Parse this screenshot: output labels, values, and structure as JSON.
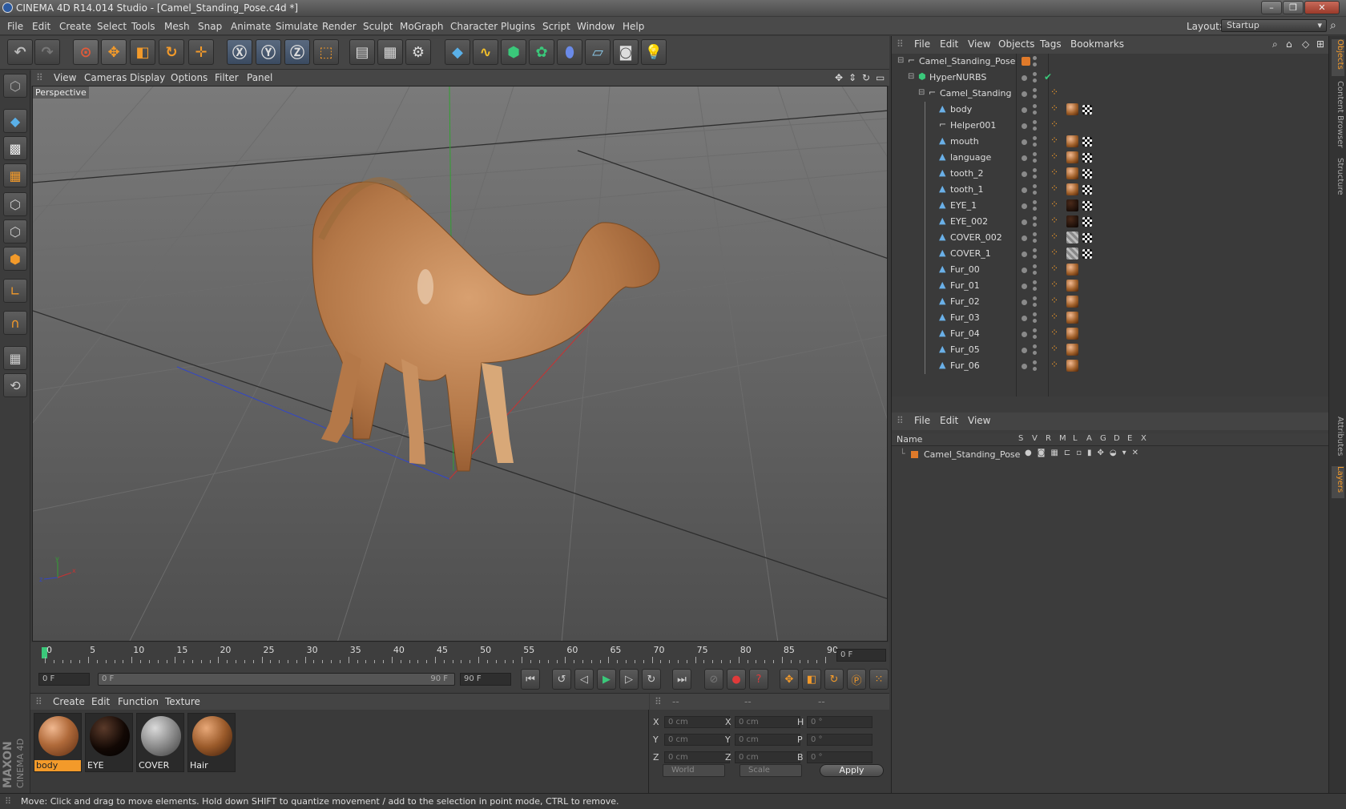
{
  "window": {
    "title": "CINEMA 4D R14.014 Studio - [Camel_Standing_Pose.c4d *]",
    "buttons": [
      "–",
      "❐",
      "✕"
    ]
  },
  "menu": [
    "File",
    "Edit",
    "Create",
    "Select",
    "Tools",
    "Mesh",
    "Snap",
    "Animate",
    "Simulate",
    "Render",
    "Sculpt",
    "MoGraph",
    "Character",
    "Plugins",
    "Script",
    "Window",
    "Help"
  ],
  "layout": {
    "label": "Layout:",
    "value": "Startup"
  },
  "viewport": {
    "menu": [
      "View",
      "Cameras",
      "Display",
      "Options",
      "Filter",
      "Panel"
    ],
    "label": "Perspective"
  },
  "timeline": {
    "ticks": [
      "0",
      "5",
      "10",
      "15",
      "20",
      "25",
      "30",
      "35",
      "40",
      "45",
      "50",
      "55",
      "60",
      "65",
      "70",
      "75",
      "80",
      "85",
      "90"
    ],
    "current_frame": "0 F"
  },
  "transport": {
    "start": "0 F",
    "range_start": "0 F",
    "range_end": "90 F",
    "end": "90 F"
  },
  "material_panel": {
    "menu": [
      "Create",
      "Edit",
      "Function",
      "Texture"
    ],
    "materials": [
      {
        "name": "body",
        "color": "#b06a3a",
        "selected": true
      },
      {
        "name": "EYE",
        "color": "#120804",
        "selected": false
      },
      {
        "name": "COVER",
        "color": "#8a8a8a",
        "selected": false
      },
      {
        "name": "Hair",
        "color": "#9a5a2a",
        "selected": false
      }
    ]
  },
  "coord_panel": {
    "headers": [
      "--",
      "--",
      "--"
    ],
    "rows": [
      {
        "a": "X",
        "av": "0 cm",
        "b": "X",
        "bv": "0 cm",
        "c": "H",
        "cv": "0 °"
      },
      {
        "a": "Y",
        "av": "0 cm",
        "b": "Y",
        "bv": "0 cm",
        "c": "P",
        "cv": "0 °"
      },
      {
        "a": "Z",
        "av": "0 cm",
        "b": "Z",
        "bv": "0 cm",
        "c": "B",
        "cv": "0 °"
      }
    ],
    "mode": "World",
    "size_mode": "Scale",
    "apply": "Apply"
  },
  "object_manager": {
    "menu": [
      "File",
      "Edit",
      "View",
      "Objects",
      "Tags",
      "Bookmarks"
    ],
    "objects": [
      {
        "name": "Camel_Standing_Pose",
        "depth": 0,
        "icon": "null",
        "tags": "none"
      },
      {
        "name": "HyperNURBS",
        "depth": 1,
        "icon": "nurbs",
        "tags": "check"
      },
      {
        "name": "Camel_Standing",
        "depth": 2,
        "icon": "null",
        "tags": "phong"
      },
      {
        "name": "body",
        "depth": 3,
        "icon": "poly",
        "tags": "skin"
      },
      {
        "name": "Helper001",
        "depth": 3,
        "icon": "null",
        "tags": "phong"
      },
      {
        "name": "mouth",
        "depth": 3,
        "icon": "poly",
        "tags": "skin"
      },
      {
        "name": "language",
        "depth": 3,
        "icon": "poly",
        "tags": "skin"
      },
      {
        "name": "tooth_2",
        "depth": 3,
        "icon": "poly",
        "tags": "skin"
      },
      {
        "name": "tooth_1",
        "depth": 3,
        "icon": "poly",
        "tags": "skin"
      },
      {
        "name": "EYE_1",
        "depth": 3,
        "icon": "poly",
        "tags": "eye"
      },
      {
        "name": "EYE_002",
        "depth": 3,
        "icon": "poly",
        "tags": "eye"
      },
      {
        "name": "COVER_002",
        "depth": 3,
        "icon": "poly",
        "tags": "cover"
      },
      {
        "name": "COVER_1",
        "depth": 3,
        "icon": "poly",
        "tags": "cover"
      },
      {
        "name": "Fur_00",
        "depth": 3,
        "icon": "poly",
        "tags": "fur"
      },
      {
        "name": "Fur_01",
        "depth": 3,
        "icon": "poly",
        "tags": "fur"
      },
      {
        "name": "Fur_02",
        "depth": 3,
        "icon": "poly",
        "tags": "fur"
      },
      {
        "name": "Fur_03",
        "depth": 3,
        "icon": "poly",
        "tags": "fur"
      },
      {
        "name": "Fur_04",
        "depth": 3,
        "icon": "poly",
        "tags": "fur"
      },
      {
        "name": "Fur_05",
        "depth": 3,
        "icon": "poly",
        "tags": "fur"
      },
      {
        "name": "Fur_06",
        "depth": 3,
        "icon": "poly",
        "tags": "fur"
      }
    ]
  },
  "layer_manager": {
    "menu": [
      "File",
      "Edit",
      "View"
    ],
    "columns": [
      "Name",
      "S",
      "V",
      "R",
      "M",
      "L",
      "A",
      "G",
      "D",
      "E",
      "X"
    ],
    "layers": [
      {
        "name": "Camel_Standing_Pose",
        "color": "#e07a2a"
      }
    ]
  },
  "side_tabs": [
    "Objects",
    "Content Browser",
    "Structure",
    "Attributes",
    "Layers"
  ],
  "brand": [
    "MAXON",
    "CINEMA 4D"
  ],
  "status": "Move: Click and drag to move elements. Hold down SHIFT to quantize movement / add to the selection in point mode, CTRL to remove.",
  "colors": {
    "accent": "#f39a2a",
    "x_axis": "#c83232",
    "y_axis": "#32a032",
    "z_axis": "#3246c8"
  }
}
